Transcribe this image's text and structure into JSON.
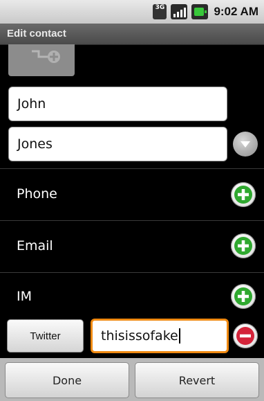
{
  "status_bar": {
    "network": "3G",
    "time": "9:02 AM"
  },
  "title_bar": {
    "title": "Edit contact"
  },
  "name": {
    "first_name": "John",
    "last_name": "Jones"
  },
  "sections": [
    {
      "label": "Phone",
      "action_icon": "add-icon"
    },
    {
      "label": "Email",
      "action_icon": "add-icon"
    },
    {
      "label": "IM",
      "action_icon": "add-icon"
    }
  ],
  "im_entry": {
    "type_label": "Twitter",
    "value": "thisissofake",
    "remove_icon": "remove-icon"
  },
  "bottom_bar": {
    "done_label": "Done",
    "revert_label": "Revert"
  },
  "colors": {
    "add_green": "#2fa82f",
    "remove_red": "#d4243a",
    "focus_orange": "#f08a12"
  }
}
